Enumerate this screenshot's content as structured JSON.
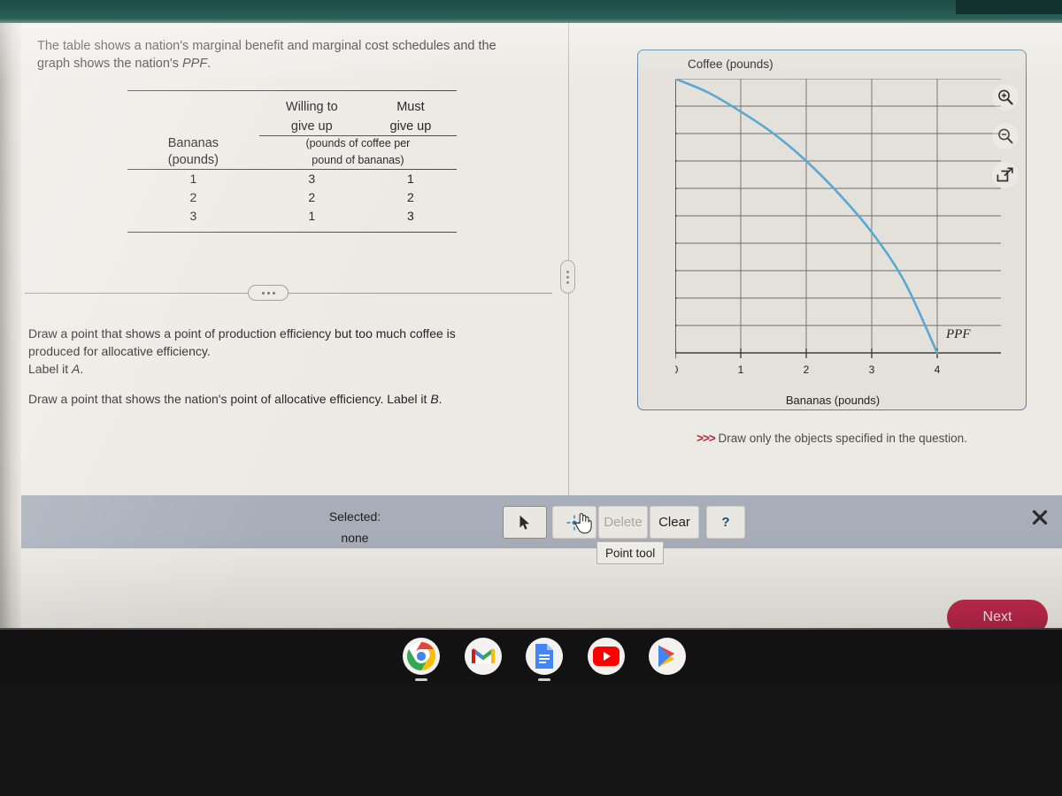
{
  "prompt": {
    "line1": "The table shows a nation's marginal benefit and marginal cost schedules and the",
    "line2_pre": "graph shows the nation's ",
    "line2_em": "PPF",
    "line2_post": "."
  },
  "table": {
    "header": {
      "col1_line1": "Bananas",
      "col1_line2": "(pounds)",
      "col2_line1": "Willing to",
      "col2_line2": "give up",
      "col3_line1": "Must",
      "col3_line2": "give up",
      "unit_line1": "(pounds of coffee per",
      "unit_line2": "pound of bananas)"
    },
    "rows": [
      {
        "bananas": "1",
        "willing": "3",
        "must": "1"
      },
      {
        "bananas": "2",
        "willing": "2",
        "must": "2"
      },
      {
        "bananas": "3",
        "willing": "1",
        "must": "3"
      }
    ]
  },
  "tasks": {
    "a_line1": "Draw a point that shows a point of production efficiency but too much coffee is",
    "a_line2": "produced for allocative efficiency.",
    "a_line3_pre": "Label it ",
    "a_line3_em": "A",
    "a_line3_post": ".",
    "b_pre": "Draw a point that shows the nation's point of allocative efficiency. Label it ",
    "b_em": "B",
    "b_post": "."
  },
  "chart_data": {
    "type": "line",
    "title": "Coffee (pounds)",
    "xlabel": "Bananas (pounds)",
    "ylabel": "Coffee (pounds)",
    "xlim": [
      0,
      4.6
    ],
    "ylim": [
      0,
      10
    ],
    "xticks": [
      "0",
      "1",
      "2",
      "3",
      "4"
    ],
    "yticks": [
      "0",
      "1",
      "2",
      "3",
      "4",
      "5",
      "6",
      "7",
      "8",
      "9",
      "10"
    ],
    "grid": true,
    "legend": "none",
    "series": [
      {
        "name": "PPF",
        "color": "#5aa8d6",
        "annotation": "PPF",
        "x": [
          0,
          0.5,
          1,
          1.5,
          2,
          2.5,
          3,
          3.5,
          4
        ],
        "y": [
          10,
          9.5,
          8.8,
          8.0,
          7.0,
          5.8,
          4.4,
          2.6,
          0
        ]
      }
    ]
  },
  "graph_buttons": {
    "zoom_in": "zoom-in",
    "zoom_out": "zoom-out",
    "expand": "open-in-new"
  },
  "hint": {
    "arrows": ">>>",
    "text": "Draw only the objects specified in the question."
  },
  "toolbar": {
    "selected_label": "Selected:",
    "selected_value": "none",
    "select_tool": "select-arrow",
    "point_tool": "point-tool",
    "delete_label": "Delete",
    "clear_label": "Clear",
    "help_label": "?",
    "tooltip": "Point tool",
    "close": "close"
  },
  "next_button": {
    "label": "Next"
  },
  "taskbar": {
    "icons": [
      "chrome",
      "gmail",
      "docs",
      "youtube",
      "play-store"
    ]
  },
  "colors": {
    "accent_blue": "#5aa8d6",
    "panel_border": "#5b7fa6",
    "toolbar_bg": "#a7aeba",
    "next_bg": "#b72649",
    "hint_red": "#b02a37"
  }
}
